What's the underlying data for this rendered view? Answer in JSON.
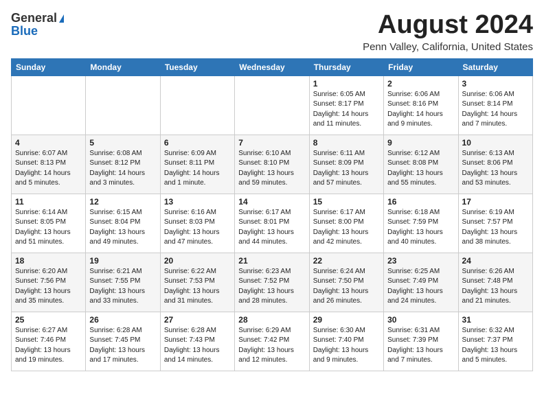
{
  "header": {
    "logo_general": "General",
    "logo_blue": "Blue",
    "month_title": "August 2024",
    "location": "Penn Valley, California, United States"
  },
  "days_of_week": [
    "Sunday",
    "Monday",
    "Tuesday",
    "Wednesday",
    "Thursday",
    "Friday",
    "Saturday"
  ],
  "weeks": [
    [
      {
        "day": "",
        "sunrise": "",
        "sunset": "",
        "daylight": ""
      },
      {
        "day": "",
        "sunrise": "",
        "sunset": "",
        "daylight": ""
      },
      {
        "day": "",
        "sunrise": "",
        "sunset": "",
        "daylight": ""
      },
      {
        "day": "",
        "sunrise": "",
        "sunset": "",
        "daylight": ""
      },
      {
        "day": "1",
        "sunrise": "Sunrise: 6:05 AM",
        "sunset": "Sunset: 8:17 PM",
        "daylight": "Daylight: 14 hours and 11 minutes."
      },
      {
        "day": "2",
        "sunrise": "Sunrise: 6:06 AM",
        "sunset": "Sunset: 8:16 PM",
        "daylight": "Daylight: 14 hours and 9 minutes."
      },
      {
        "day": "3",
        "sunrise": "Sunrise: 6:06 AM",
        "sunset": "Sunset: 8:14 PM",
        "daylight": "Daylight: 14 hours and 7 minutes."
      }
    ],
    [
      {
        "day": "4",
        "sunrise": "Sunrise: 6:07 AM",
        "sunset": "Sunset: 8:13 PM",
        "daylight": "Daylight: 14 hours and 5 minutes."
      },
      {
        "day": "5",
        "sunrise": "Sunrise: 6:08 AM",
        "sunset": "Sunset: 8:12 PM",
        "daylight": "Daylight: 14 hours and 3 minutes."
      },
      {
        "day": "6",
        "sunrise": "Sunrise: 6:09 AM",
        "sunset": "Sunset: 8:11 PM",
        "daylight": "Daylight: 14 hours and 1 minute."
      },
      {
        "day": "7",
        "sunrise": "Sunrise: 6:10 AM",
        "sunset": "Sunset: 8:10 PM",
        "daylight": "Daylight: 13 hours and 59 minutes."
      },
      {
        "day": "8",
        "sunrise": "Sunrise: 6:11 AM",
        "sunset": "Sunset: 8:09 PM",
        "daylight": "Daylight: 13 hours and 57 minutes."
      },
      {
        "day": "9",
        "sunrise": "Sunrise: 6:12 AM",
        "sunset": "Sunset: 8:08 PM",
        "daylight": "Daylight: 13 hours and 55 minutes."
      },
      {
        "day": "10",
        "sunrise": "Sunrise: 6:13 AM",
        "sunset": "Sunset: 8:06 PM",
        "daylight": "Daylight: 13 hours and 53 minutes."
      }
    ],
    [
      {
        "day": "11",
        "sunrise": "Sunrise: 6:14 AM",
        "sunset": "Sunset: 8:05 PM",
        "daylight": "Daylight: 13 hours and 51 minutes."
      },
      {
        "day": "12",
        "sunrise": "Sunrise: 6:15 AM",
        "sunset": "Sunset: 8:04 PM",
        "daylight": "Daylight: 13 hours and 49 minutes."
      },
      {
        "day": "13",
        "sunrise": "Sunrise: 6:16 AM",
        "sunset": "Sunset: 8:03 PM",
        "daylight": "Daylight: 13 hours and 47 minutes."
      },
      {
        "day": "14",
        "sunrise": "Sunrise: 6:17 AM",
        "sunset": "Sunset: 8:01 PM",
        "daylight": "Daylight: 13 hours and 44 minutes."
      },
      {
        "day": "15",
        "sunrise": "Sunrise: 6:17 AM",
        "sunset": "Sunset: 8:00 PM",
        "daylight": "Daylight: 13 hours and 42 minutes."
      },
      {
        "day": "16",
        "sunrise": "Sunrise: 6:18 AM",
        "sunset": "Sunset: 7:59 PM",
        "daylight": "Daylight: 13 hours and 40 minutes."
      },
      {
        "day": "17",
        "sunrise": "Sunrise: 6:19 AM",
        "sunset": "Sunset: 7:57 PM",
        "daylight": "Daylight: 13 hours and 38 minutes."
      }
    ],
    [
      {
        "day": "18",
        "sunrise": "Sunrise: 6:20 AM",
        "sunset": "Sunset: 7:56 PM",
        "daylight": "Daylight: 13 hours and 35 minutes."
      },
      {
        "day": "19",
        "sunrise": "Sunrise: 6:21 AM",
        "sunset": "Sunset: 7:55 PM",
        "daylight": "Daylight: 13 hours and 33 minutes."
      },
      {
        "day": "20",
        "sunrise": "Sunrise: 6:22 AM",
        "sunset": "Sunset: 7:53 PM",
        "daylight": "Daylight: 13 hours and 31 minutes."
      },
      {
        "day": "21",
        "sunrise": "Sunrise: 6:23 AM",
        "sunset": "Sunset: 7:52 PM",
        "daylight": "Daylight: 13 hours and 28 minutes."
      },
      {
        "day": "22",
        "sunrise": "Sunrise: 6:24 AM",
        "sunset": "Sunset: 7:50 PM",
        "daylight": "Daylight: 13 hours and 26 minutes."
      },
      {
        "day": "23",
        "sunrise": "Sunrise: 6:25 AM",
        "sunset": "Sunset: 7:49 PM",
        "daylight": "Daylight: 13 hours and 24 minutes."
      },
      {
        "day": "24",
        "sunrise": "Sunrise: 6:26 AM",
        "sunset": "Sunset: 7:48 PM",
        "daylight": "Daylight: 13 hours and 21 minutes."
      }
    ],
    [
      {
        "day": "25",
        "sunrise": "Sunrise: 6:27 AM",
        "sunset": "Sunset: 7:46 PM",
        "daylight": "Daylight: 13 hours and 19 minutes."
      },
      {
        "day": "26",
        "sunrise": "Sunrise: 6:28 AM",
        "sunset": "Sunset: 7:45 PM",
        "daylight": "Daylight: 13 hours and 17 minutes."
      },
      {
        "day": "27",
        "sunrise": "Sunrise: 6:28 AM",
        "sunset": "Sunset: 7:43 PM",
        "daylight": "Daylight: 13 hours and 14 minutes."
      },
      {
        "day": "28",
        "sunrise": "Sunrise: 6:29 AM",
        "sunset": "Sunset: 7:42 PM",
        "daylight": "Daylight: 13 hours and 12 minutes."
      },
      {
        "day": "29",
        "sunrise": "Sunrise: 6:30 AM",
        "sunset": "Sunset: 7:40 PM",
        "daylight": "Daylight: 13 hours and 9 minutes."
      },
      {
        "day": "30",
        "sunrise": "Sunrise: 6:31 AM",
        "sunset": "Sunset: 7:39 PM",
        "daylight": "Daylight: 13 hours and 7 minutes."
      },
      {
        "day": "31",
        "sunrise": "Sunrise: 6:32 AM",
        "sunset": "Sunset: 7:37 PM",
        "daylight": "Daylight: 13 hours and 5 minutes."
      }
    ]
  ]
}
